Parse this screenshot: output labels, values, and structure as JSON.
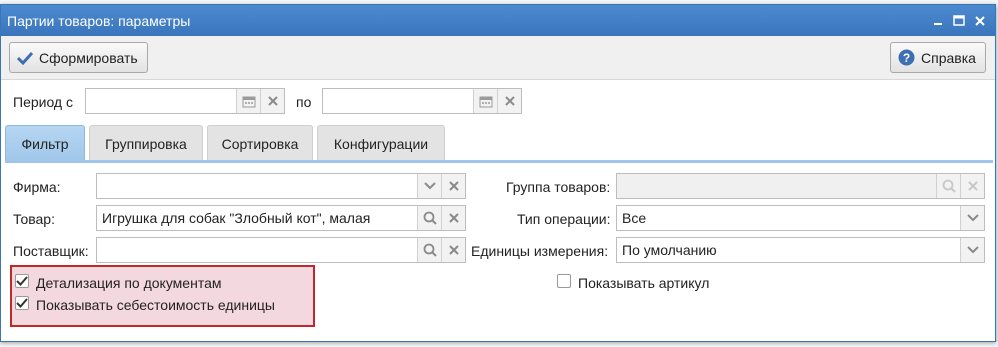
{
  "window": {
    "title": "Партии товаров: параметры"
  },
  "toolbar": {
    "generate_label": "Сформировать",
    "help_label": "Справка"
  },
  "period": {
    "from_label": "Период с",
    "from_value": "",
    "to_label": "по",
    "to_value": ""
  },
  "tabs": [
    {
      "label": "Фильтр",
      "active": true
    },
    {
      "label": "Группировка",
      "active": false
    },
    {
      "label": "Сортировка",
      "active": false
    },
    {
      "label": "Конфигурации",
      "active": false
    }
  ],
  "filter": {
    "firm_label": "Фирма:",
    "firm_value": "",
    "product_label": "Товар:",
    "product_value": "Игрушка для собак \"Злобный кот\", малая",
    "supplier_label": "Поставщик:",
    "supplier_value": "",
    "group_label": "Группа товаров:",
    "group_value": "",
    "optype_label": "Тип операции:",
    "optype_value": "Все",
    "units_label": "Единицы измерения:",
    "units_value": "По умолчанию"
  },
  "options": {
    "detail_label": "Детализация по документам",
    "detail_checked": true,
    "cost_label": "Показывать себестоимость единицы",
    "cost_checked": true,
    "article_label": "Показывать артикул",
    "article_checked": false
  },
  "colors": {
    "accent": "#3a75bc",
    "highlight_border": "#c0282c",
    "tab_active": "#a0c7ea"
  }
}
